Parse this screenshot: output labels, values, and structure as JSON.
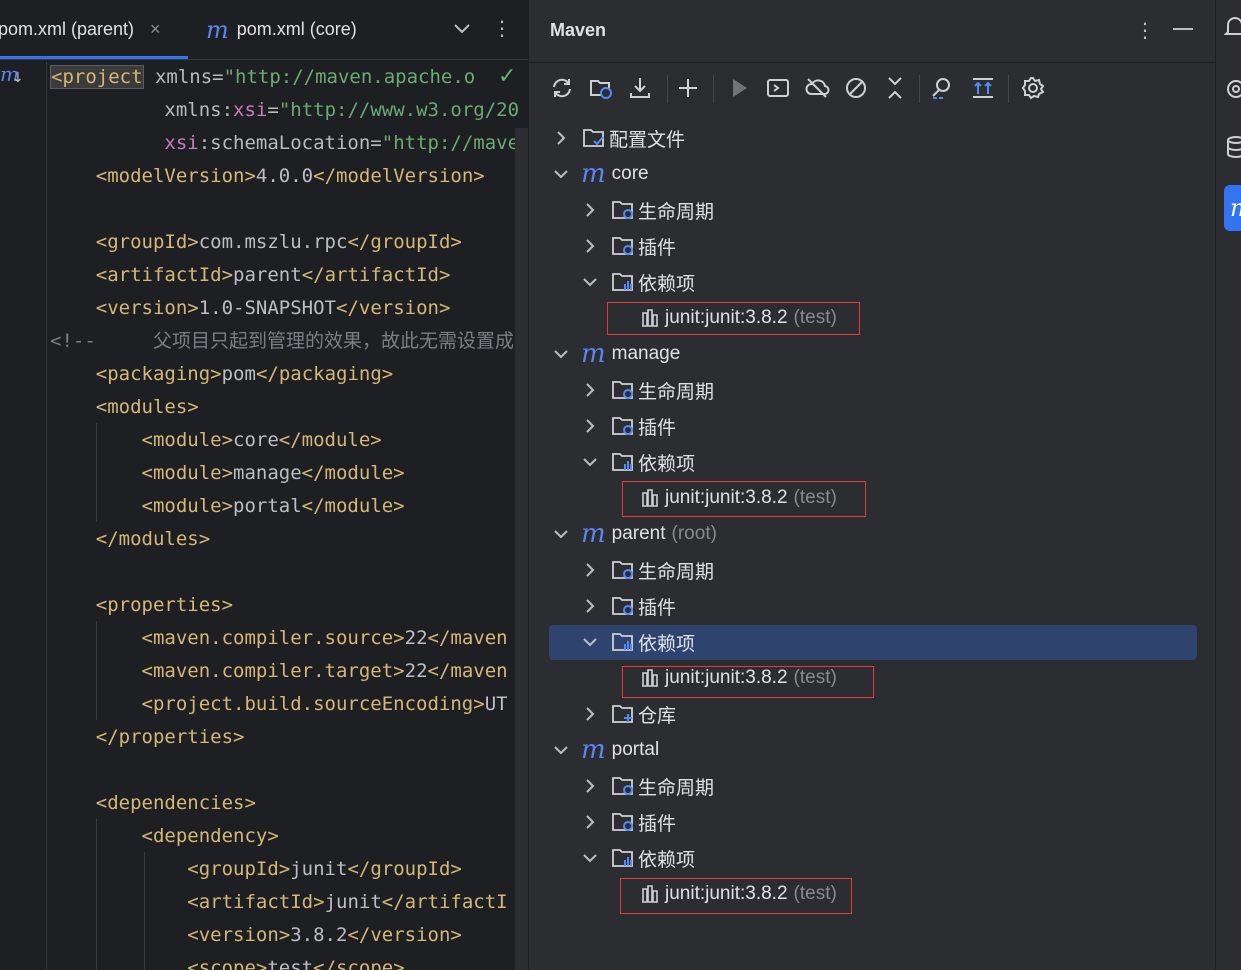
{
  "editor": {
    "tabs": [
      {
        "label": "pom.xml (parent)",
        "close": "×"
      },
      {
        "label": "pom.xml (core)",
        "icon": "m"
      }
    ],
    "more": "⋮",
    "code": {
      "l1_tag": "<project",
      "l1_attr": " xmlns=",
      "l1_val": "\"http://maven.apache.o",
      "l2_attr": "xmlns:",
      "l2_ns": "xsi",
      "l2_eq": "=",
      "l2_val": "\"http://www.w3.org/20",
      "l3_ns": "xsi",
      "l3_attr": ":schemaLocation=",
      "l3_val": "\"http://mave",
      "modelVersion_open": "<modelVersion>",
      "modelVersion": "4.0.0",
      "modelVersion_close": "</modelVersion>",
      "groupId_open": "<groupId>",
      "groupId": "com.mszlu.rpc",
      "groupId_close": "</groupId>",
      "artifactId_open": "<artifactId>",
      "artifactId": "parent",
      "artifactId_close": "</artifactId>",
      "version_open": "<version>",
      "version": "1.0-SNAPSHOT",
      "version_close": "</version>",
      "comment": "<!--     父项目只起到管理的效果，故此无需设置成ja",
      "packaging_open": "<packaging>",
      "packaging": "pom",
      "packaging_close": "</packaging>",
      "modules_open": "<modules>",
      "module_open": "<module>",
      "module_close": "</module>",
      "module_core": "core",
      "module_manage": "manage",
      "module_portal": "portal",
      "modules_close": "</modules>",
      "properties_open": "<properties>",
      "prop1_open": "<maven.compiler.source>",
      "prop1_val": "22",
      "prop1_close": "</maven",
      "prop2_open": "<maven.compiler.target>",
      "prop2_val": "22",
      "prop2_close": "</maven",
      "prop3_open": "<project.build.sourceEncoding>",
      "prop3_val": "UT",
      "properties_close": "</properties>",
      "dependencies_open": "<dependencies>",
      "dependency_open": "<dependency>",
      "dep_groupId_open": "<groupId>",
      "dep_groupId": "junit",
      "dep_groupId_close": "</groupId>",
      "dep_artifactId_open": "<artifactId>",
      "dep_artifactId": "junit",
      "dep_artifactId_close": "</artifactI",
      "dep_version_open": "<version>",
      "dep_version": "3.8.2",
      "dep_version_close": "</version>",
      "dep_scope_open": "<scope>",
      "dep_scope": "test",
      "dep_scope_close": "</scope>"
    }
  },
  "maven": {
    "title": "Maven",
    "more": "⋮",
    "tree": {
      "profiles": "配置文件",
      "lifecycle": "生命周期",
      "plugins": "插件",
      "dependencies": "依赖项",
      "repositories": "仓库",
      "module_icon": "m",
      "root_suffix": "(root)",
      "dep_name": "junit:junit:3.8.2",
      "dep_scope": "(test)",
      "modules": [
        "core",
        "manage",
        "parent",
        "portal"
      ]
    }
  },
  "colors": {
    "accent": "#3574f0",
    "selection": "#2e436e",
    "highlight_box": "#e5393b"
  }
}
